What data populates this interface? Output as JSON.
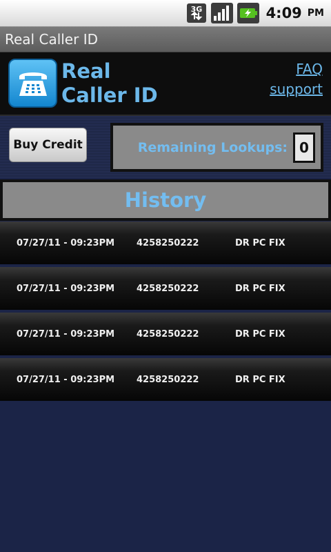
{
  "status_bar": {
    "network_icon": "3g-icon",
    "signal_icon": "signal-icon",
    "battery_icon": "battery-charging-icon",
    "time": "4:09",
    "ampm": "PM"
  },
  "title_bar": {
    "title": "Real Caller ID"
  },
  "header": {
    "icon": "telephone-icon",
    "name_line1": "Real",
    "name_line2": "Caller ID",
    "faq_link": "FAQ",
    "support_link": "support"
  },
  "credit": {
    "buy_button": "Buy Credit",
    "remaining_label": "Remaining Lookups:",
    "remaining_count": "0"
  },
  "history": {
    "title": "History",
    "rows": [
      {
        "datetime": "07/27/11 - 09:23PM",
        "number": "4258250222",
        "name": "DR PC FIX"
      },
      {
        "datetime": "07/27/11 - 09:23PM",
        "number": "4258250222",
        "name": "DR PC FIX"
      },
      {
        "datetime": "07/27/11 - 09:23PM",
        "number": "4258250222",
        "name": "DR PC FIX"
      },
      {
        "datetime": "07/27/11 - 09:23PM",
        "number": "4258250222",
        "name": "DR PC FIX"
      }
    ]
  },
  "colors": {
    "accent_blue": "#6cb8ea",
    "background": "#1b2447"
  }
}
